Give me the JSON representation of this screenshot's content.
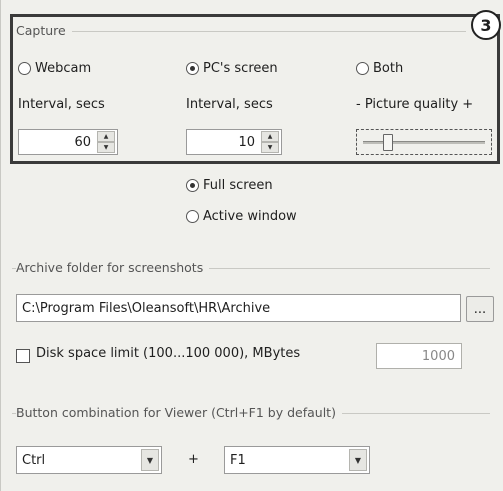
{
  "capture_group": {
    "title": "Capture",
    "badge": "3",
    "source_options": [
      {
        "label": "Webcam",
        "selected": false
      },
      {
        "label": "PC's screen",
        "selected": true
      },
      {
        "label": "Both",
        "selected": false
      }
    ],
    "webcam_interval_label": "Interval, secs",
    "webcam_interval_value": "60",
    "screen_interval_label": "Interval, secs",
    "screen_interval_value": "10",
    "quality_label": "- Picture quality +",
    "quality_level": 0.18
  },
  "screen_mode": {
    "options": [
      {
        "label": "Full screen",
        "selected": true
      },
      {
        "label": "Active window",
        "selected": false
      }
    ]
  },
  "archive_group": {
    "title": "Archive folder for screenshots",
    "path": "C:\\Program Files\\Oleansoft\\HR\\Archive",
    "browse_label": "...",
    "disk_limit_label": "Disk space limit (100...100 000), MBytes",
    "disk_limit_checked": false,
    "disk_limit_value": "1000"
  },
  "viewer_hotkey_group": {
    "title": "Button combination for Viewer (Ctrl+F1 by default)",
    "modifier": "Ctrl",
    "plus": "+",
    "key": "F1"
  },
  "icons": {
    "dropdown_arrow": "chevron-down-icon",
    "spin_up": "spin-up-icon",
    "spin_down": "spin-down-icon"
  }
}
